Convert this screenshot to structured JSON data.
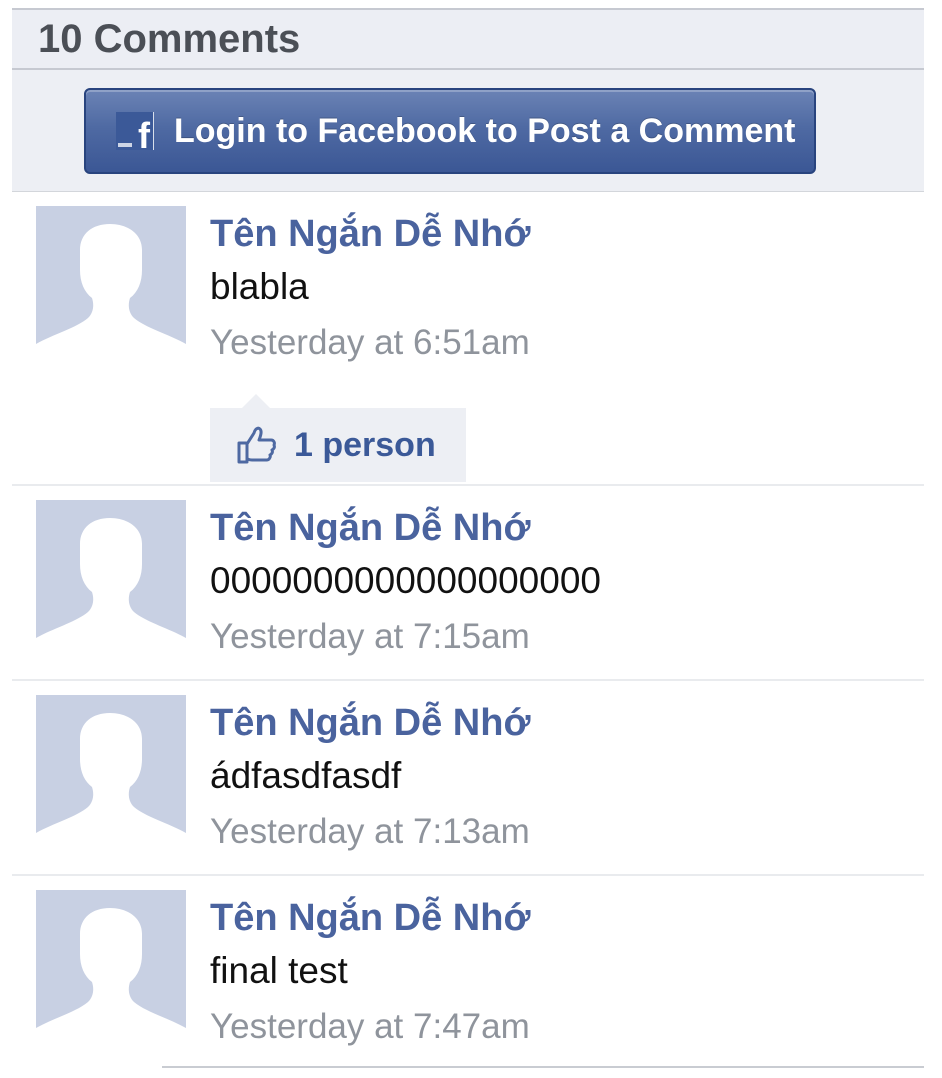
{
  "header": {
    "title": "10 Comments"
  },
  "login": {
    "label": "Login to Facebook to Post a Comment",
    "icon": "facebook-icon"
  },
  "colors": {
    "brand_blue": "#3b5998",
    "author_blue": "#4a639e",
    "avatar_bg": "#c8d0e3",
    "header_bg": "#eceef4"
  },
  "comments": [
    {
      "author": "Tên Ngắn Dễ Nhớ",
      "text": "blabla",
      "time": "Yesterday at 6:51am",
      "likes": "1 person"
    },
    {
      "author": "Tên Ngắn Dễ Nhớ",
      "text": "0000000000000000000",
      "time": "Yesterday at 7:15am"
    },
    {
      "author": "Tên Ngắn Dễ Nhớ",
      "text": "ádfasdfasdf",
      "time": "Yesterday at 7:13am"
    },
    {
      "author": "Tên Ngắn Dễ Nhớ",
      "text": "final test",
      "time": "Yesterday at 7:47am"
    }
  ]
}
